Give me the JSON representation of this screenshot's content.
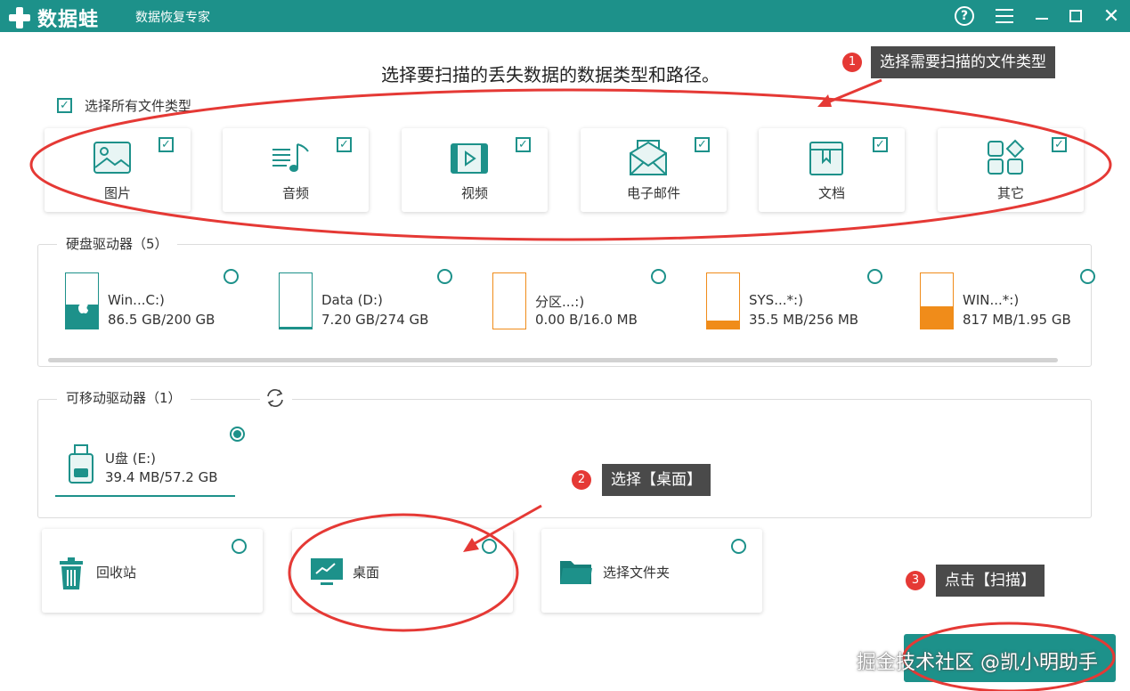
{
  "app": {
    "logo_text": "数据蛙",
    "subtitle": "数据恢复专家"
  },
  "headline": "选择要扫描的丢失数据的数据类型和路径。",
  "select_all": {
    "label": "选择所有文件类型",
    "checked": true
  },
  "file_types": [
    {
      "label": "图片",
      "icon": "image-icon",
      "checked": true
    },
    {
      "label": "音频",
      "icon": "music-icon",
      "checked": true
    },
    {
      "label": "视频",
      "icon": "video-icon",
      "checked": true
    },
    {
      "label": "电子邮件",
      "icon": "email-icon",
      "checked": true
    },
    {
      "label": "文档",
      "icon": "document-icon",
      "checked": true
    },
    {
      "label": "其它",
      "icon": "other-icon",
      "checked": true
    }
  ],
  "hard_drives": {
    "title": "硬盘驱动器（5）",
    "items": [
      {
        "name": "Win...C:)",
        "size": "86.5 GB/200 GB",
        "used_fraction": 0.43,
        "color": "#1d918a",
        "selected": false
      },
      {
        "name": "Data (D:)",
        "size": "7.20 GB/274 GB",
        "used_fraction": 0.03,
        "color": "#1d918a",
        "selected": false
      },
      {
        "name": "分区...:)",
        "size": "0.00  B/16.0 MB",
        "used_fraction": 0.0,
        "color": "#f08c1a",
        "selected": false
      },
      {
        "name": "SYS...*:)",
        "size": "35.5 MB/256 MB",
        "used_fraction": 0.14,
        "color": "#f08c1a",
        "selected": false
      },
      {
        "name": "WIN...*:)",
        "size": "817 MB/1.95 GB",
        "used_fraction": 0.41,
        "color": "#f08c1a",
        "selected": false
      }
    ]
  },
  "removable_drives": {
    "title": "可移动驱动器（1）",
    "items": [
      {
        "name": "U盘 (E:)",
        "size": "39.4 MB/57.2 GB",
        "selected": true
      }
    ]
  },
  "locations": [
    {
      "label": "回收站",
      "icon": "recycle-bin-icon",
      "selected": false
    },
    {
      "label": "桌面",
      "icon": "desktop-icon",
      "selected": false
    },
    {
      "label": "选择文件夹",
      "icon": "folder-icon",
      "selected": false
    }
  ],
  "annotations": [
    {
      "num": "1",
      "text": "选择需要扫描的文件类型"
    },
    {
      "num": "2",
      "text": "选择【桌面】"
    },
    {
      "num": "3",
      "text": "点击【扫描】"
    }
  ],
  "watermark": "掘金技术社区 @凯小明助手",
  "colors": {
    "accent": "#1d918a",
    "orange": "#f08c1a",
    "annotation_red": "#e53935"
  }
}
